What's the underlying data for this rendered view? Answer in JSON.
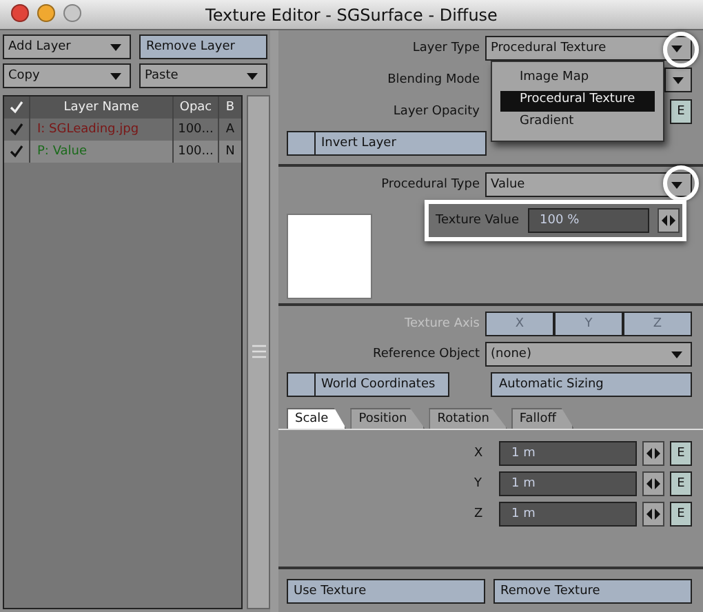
{
  "window": {
    "title": "Texture Editor - SGSurface - Diffuse",
    "buttons": [
      {
        "color": "#e0443a"
      },
      {
        "color": "#f0a830"
      },
      {
        "color": "#c8c8c8"
      }
    ]
  },
  "layer_controls": {
    "add_layer": "Add Layer",
    "remove_layer": "Remove Layer",
    "copy": "Copy",
    "paste": "Paste"
  },
  "layer_table": {
    "columns": [
      "Layer Name",
      "Opac",
      "B"
    ],
    "rows": [
      {
        "enabled": true,
        "name": "I: SGLeading.jpg",
        "color": "#7a1616",
        "opacity": "100...",
        "blend": "A",
        "selected": false
      },
      {
        "enabled": true,
        "name": "P: Value",
        "color": "#1a6a1a",
        "opacity": "100...",
        "blend": "N",
        "selected": true
      }
    ]
  },
  "layer": {
    "type_label": "Layer Type",
    "type_value": "Procedural Texture",
    "blending_label": "Blending Mode",
    "opacity_label": "Layer Opacity",
    "opacity_envelope": "E",
    "invert": {
      "label": "Invert Layer",
      "checked": false
    }
  },
  "layer_type_menu": {
    "options": [
      {
        "label": "Image Map",
        "selected": false
      },
      {
        "label": "Procedural Texture",
        "selected": true
      },
      {
        "label": "Gradient",
        "selected": false
      }
    ]
  },
  "procedural": {
    "type_label": "Procedural Type",
    "type_value": "Value",
    "value_label": "Texture Value",
    "value": "100 %"
  },
  "mapping": {
    "axis_label": "Texture Axis",
    "axis_disabled": true,
    "axes": [
      "X",
      "Y",
      "Z"
    ],
    "reference_label": "Reference Object",
    "reference_value": "(none)",
    "world_coordinates": {
      "label": "World Coordinates",
      "checked": false
    },
    "automatic_sizing": "Automatic Sizing"
  },
  "tabs": [
    {
      "label": "Scale",
      "selected": true
    },
    {
      "label": "Position",
      "selected": false
    },
    {
      "label": "Rotation",
      "selected": false
    },
    {
      "label": "Falloff",
      "selected": false
    }
  ],
  "scale_fields": [
    {
      "axis": "X",
      "value": "1 m",
      "envelope": "E"
    },
    {
      "axis": "Y",
      "value": "1 m",
      "envelope": "E"
    },
    {
      "axis": "Z",
      "value": "1 m",
      "envelope": "E"
    }
  ],
  "footer": {
    "use_texture": "Use Texture",
    "remove_texture": "Remove Texture"
  }
}
